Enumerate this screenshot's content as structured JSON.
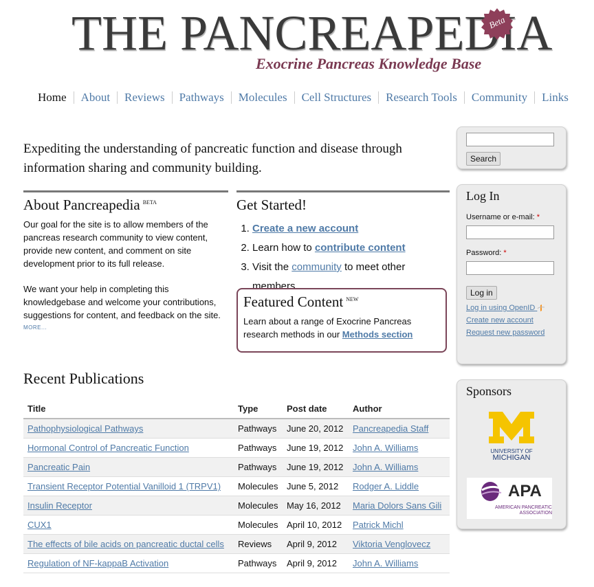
{
  "header": {
    "logo_title": "The Pancreapedia",
    "logo_badge": "Beta",
    "logo_subtitle": "Exocrine Pancreas Knowledge Base"
  },
  "nav": {
    "items": [
      "Home",
      "About",
      "Reviews",
      "Pathways",
      "Molecules",
      "Cell Structures",
      "Research Tools",
      "Community",
      "Links"
    ]
  },
  "intro": "Expediting the understanding of pancreatic function and disease through information sharing and community building.",
  "about": {
    "title": "About Pancreapedia",
    "tag": "BETA",
    "p1": "Our goal for the site is to allow members of the pancreas research community to view content, provide new content, and comment on site development prior to its full release.",
    "p2": "We want your help in completing this knowledgebase and welcome your contributions, suggestions for content, and feedback on the site.",
    "more": "MORE..."
  },
  "get_started": {
    "title": "Get Started!",
    "step1_link": "Create a new account",
    "step2_pre": "Learn how to ",
    "step2_link": "contribute content",
    "step3_pre": "Visit the ",
    "step3_link": "community",
    "step3_post": " to meet other members"
  },
  "featured": {
    "title": "Featured Content",
    "tag": "NEW",
    "text": "Learn about a range of Exocrine Pancreas research methods in our ",
    "link": "Methods section"
  },
  "publications": {
    "title": "Recent Publications",
    "columns": [
      "Title",
      "Type",
      "Post date",
      "Author"
    ],
    "rows": [
      {
        "title": "Pathophysiological Pathways",
        "type": "Pathways",
        "date": "June 20, 2012",
        "author": "Pancreapedia Staff"
      },
      {
        "title": "Hormonal Control of Pancreatic Function",
        "type": "Pathways",
        "date": "June 19, 2012",
        "author": "John A. Williams"
      },
      {
        "title": "Pancreatic Pain",
        "type": "Pathways",
        "date": "June 19, 2012",
        "author": "John A. Williams"
      },
      {
        "title": "Transient Receptor Potential Vanilloid 1 (TRPV1)",
        "type": "Molecules",
        "date": "June 5, 2012",
        "author": "Rodger A. Liddle"
      },
      {
        "title": "Insulin Receptor",
        "type": "Molecules",
        "date": "May 16, 2012",
        "author": "Maria Dolors Sans Gili"
      },
      {
        "title": "CUX1",
        "type": "Molecules",
        "date": "April 10, 2012",
        "author": "Patrick Michl"
      },
      {
        "title": "The effects of bile acids on pancreatic ductal cells",
        "type": "Reviews",
        "date": "April 9, 2012",
        "author": "Viktoria Venglovecz"
      },
      {
        "title": "Regulation of NF-kappaB Activation",
        "type": "Pathways",
        "date": "April 9, 2012",
        "author": "John A. Williams"
      }
    ]
  },
  "sidebar": {
    "search_button": "Search",
    "login_title": "Log In",
    "username_label": "Username or e-mail:",
    "password_label": "Password:",
    "required_mark": "*",
    "login_button": "Log in",
    "openid_link": "Log in using OpenID",
    "create_link": "Create new account",
    "reset_link": "Request new password",
    "sponsors_title": "Sponsors",
    "umich_line1": "UNIVERSITY OF",
    "umich_line2": "MICHIGAN",
    "apa_logo": "APA",
    "apa_line1": "AMERICAN PANCREATIC",
    "apa_line2": "ASSOCIATION"
  },
  "colors": {
    "link": "#4f7aa7",
    "brand": "#7a3a52",
    "umich_maize": "#f5c400",
    "umich_blue": "#1f3b73",
    "apa_purple": "#6a2a7c"
  }
}
